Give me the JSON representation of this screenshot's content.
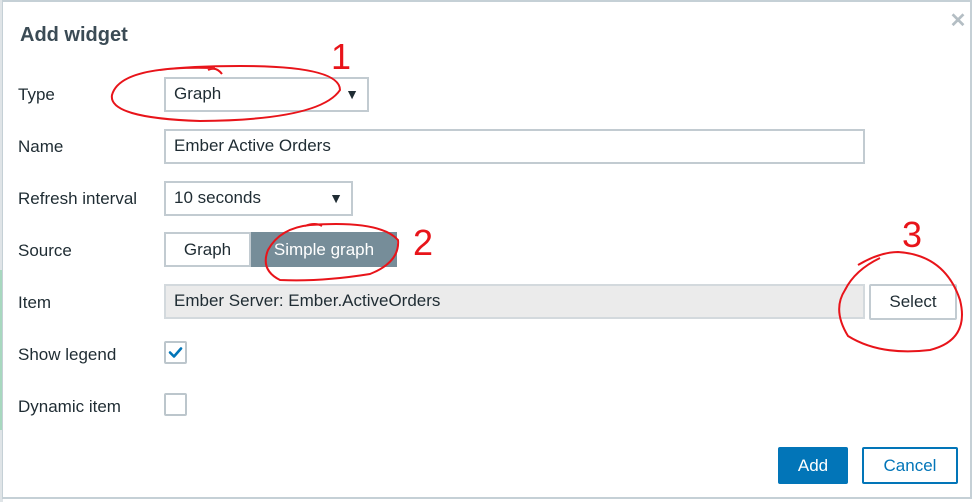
{
  "dialog": {
    "title": "Add widget",
    "close_icon": "close-icon"
  },
  "form": {
    "type": {
      "label": "Type",
      "value": "Graph"
    },
    "name": {
      "label": "Name",
      "value": "Ember Active Orders"
    },
    "refresh": {
      "label": "Refresh interval",
      "value": "10 seconds"
    },
    "source": {
      "label": "Source",
      "options": [
        "Graph",
        "Simple graph"
      ],
      "selected": "Simple graph"
    },
    "item": {
      "label": "Item",
      "value": "Ember Server: Ember.ActiveOrders",
      "select_label": "Select"
    },
    "show_legend": {
      "label": "Show legend",
      "checked": true
    },
    "dynamic_item": {
      "label": "Dynamic item",
      "checked": false
    }
  },
  "footer": {
    "add_label": "Add",
    "cancel_label": "Cancel"
  },
  "annotations": {
    "one": "1",
    "two": "2",
    "three": "3",
    "color": "#e8141a"
  },
  "colors": {
    "primary": "#0275b8",
    "segment_active": "#768d99",
    "title": "#3b4b55"
  }
}
